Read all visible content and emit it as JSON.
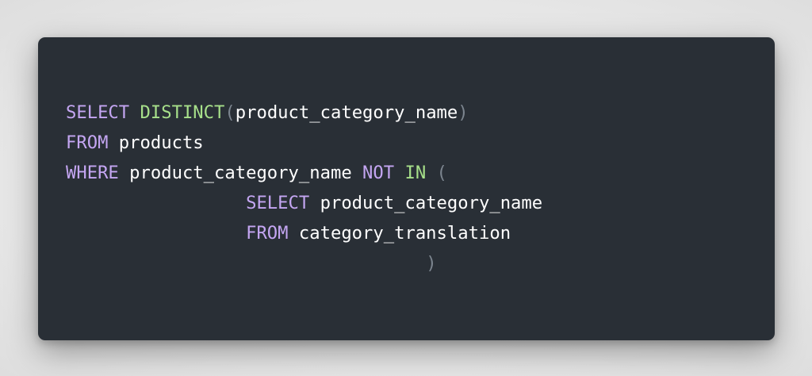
{
  "colors": {
    "background": "#e9e9e9",
    "card": "#292f36",
    "keyword": "#c4a6f2",
    "function": "#a7e08a",
    "punctuation": "#7c858f",
    "identifier": "#ffffff"
  },
  "code": {
    "language": "SQL",
    "lines": [
      [
        {
          "type": "kw",
          "text": "SELECT"
        },
        {
          "type": "id",
          "text": " "
        },
        {
          "type": "fn",
          "text": "DISTINCT"
        },
        {
          "type": "pun",
          "text": "("
        },
        {
          "type": "id",
          "text": "product_category_name"
        },
        {
          "type": "pun",
          "text": ")"
        }
      ],
      [
        {
          "type": "kw",
          "text": "FROM"
        },
        {
          "type": "id",
          "text": " products"
        }
      ],
      [
        {
          "type": "kw",
          "text": "WHERE"
        },
        {
          "type": "id",
          "text": " product_category_name "
        },
        {
          "type": "kw",
          "text": "NOT"
        },
        {
          "type": "id",
          "text": " "
        },
        {
          "type": "fn",
          "text": "IN"
        },
        {
          "type": "id",
          "text": " "
        },
        {
          "type": "pun",
          "text": "("
        }
      ],
      [
        {
          "type": "id",
          "text": "                 "
        },
        {
          "type": "kw",
          "text": "SELECT"
        },
        {
          "type": "id",
          "text": " product_category_name"
        }
      ],
      [
        {
          "type": "id",
          "text": "                 "
        },
        {
          "type": "kw",
          "text": "FROM"
        },
        {
          "type": "id",
          "text": " category_translation"
        }
      ],
      [
        {
          "type": "id",
          "text": "                                  "
        },
        {
          "type": "pun",
          "text": ")"
        }
      ]
    ]
  }
}
